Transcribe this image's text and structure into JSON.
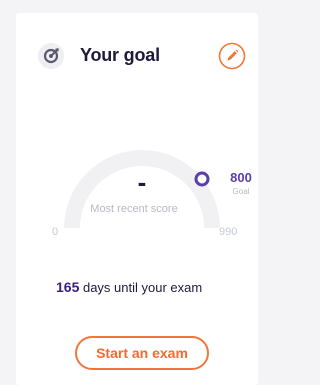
{
  "header": {
    "title": "Your goal",
    "goal_icon": "target-icon",
    "edit_icon": "pencil-icon",
    "accent_color": "#f2763a"
  },
  "gauge": {
    "score_display": "-",
    "score_label": "Most recent score",
    "min": "0",
    "max": "990",
    "goal_value": "800",
    "goal_label": "Goal",
    "goal_marker_color": "#5b3ea8",
    "track_color": "#f0f0f3"
  },
  "countdown": {
    "days": "165",
    "suffix": " days until your exam"
  },
  "actions": {
    "start_label": "Start an exam"
  }
}
